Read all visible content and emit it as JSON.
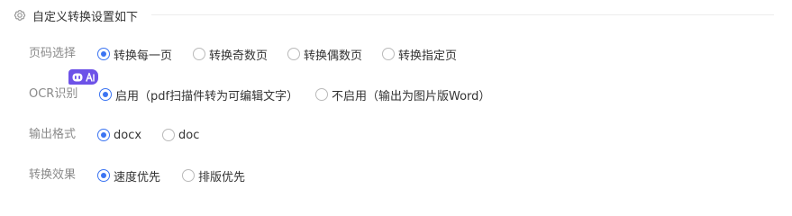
{
  "section": {
    "title": "自定义转换设置如下",
    "icon": "gear-icon"
  },
  "badge": {
    "icons": [
      "robot-icon",
      "ai-icon"
    ]
  },
  "rows": [
    {
      "label": "页码选择",
      "options": [
        "转换每一页",
        "转换奇数页",
        "转换偶数页",
        "转换指定页"
      ],
      "selected": 0
    },
    {
      "label": "OCR识别",
      "options": [
        "启用（pdf扫描件转为可编辑文字）",
        "不启用（输出为图片版Word）"
      ],
      "selected": 0
    },
    {
      "label": "输出格式",
      "options": [
        "docx",
        "doc"
      ],
      "selected": 0
    },
    {
      "label": "转换效果",
      "options": [
        "速度优先",
        "排版优先"
      ],
      "selected": 0
    }
  ],
  "colors": {
    "accent": "#3b74f2",
    "badge": "#6d52e8",
    "label": "#8a8a8a",
    "text": "#333333"
  }
}
